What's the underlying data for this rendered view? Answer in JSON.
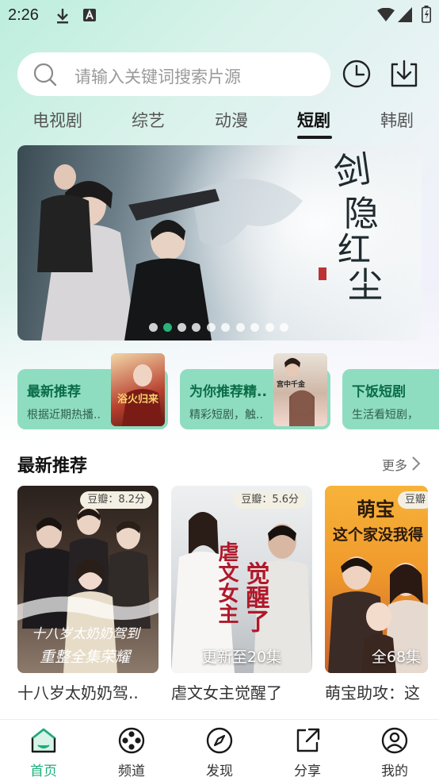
{
  "status_bar": {
    "time": "2:26"
  },
  "search": {
    "placeholder": "请输入关键词搜索片源"
  },
  "tabs": [
    {
      "label": "电视剧"
    },
    {
      "label": "综艺"
    },
    {
      "label": "动漫"
    },
    {
      "label": "短剧",
      "active": true
    },
    {
      "label": "韩剧"
    }
  ],
  "banner": {
    "title_art": "剑隐红尘",
    "active_index": 1,
    "dot_count": 10
  },
  "categories": [
    {
      "title": "最新推荐",
      "subtitle": "根据近期热播..",
      "poster_art": "浴火归来"
    },
    {
      "title": "为你推荐精..",
      "subtitle": "精彩短剧，触..",
      "poster_art": "宫中千金"
    },
    {
      "title": "下饭短剧",
      "subtitle": "生活看短剧，"
    }
  ],
  "section": {
    "title": "最新推荐",
    "more_label": "更多"
  },
  "posters": [
    {
      "score": "豆瓣：8.2分",
      "episodes": "",
      "title": "十八岁太奶奶驾..",
      "art_text": [
        "十八岁太奶奶驾到",
        "重整全集荣耀"
      ]
    },
    {
      "score": "豆瓣：5.6分",
      "episodes": "更新至20集",
      "title": "虐文女主觉醒了",
      "art_text": [
        "虐文女主",
        "觉醒了"
      ]
    },
    {
      "score": "豆瓣",
      "episodes": "全68集",
      "title": "萌宝助攻：这",
      "art_text": [
        "萌宝",
        "这个家没我得"
      ]
    }
  ],
  "bottom_nav": [
    {
      "label": "首页",
      "icon": "home-icon",
      "active": true
    },
    {
      "label": "频道",
      "icon": "film-reel-icon"
    },
    {
      "label": "发现",
      "icon": "compass-icon"
    },
    {
      "label": "分享",
      "icon": "share-icon"
    },
    {
      "label": "我的",
      "icon": "user-icon"
    }
  ],
  "colors": {
    "accent": "#1bb07a",
    "card_bg": "#8fddc1",
    "card_title": "#0a6d47"
  }
}
